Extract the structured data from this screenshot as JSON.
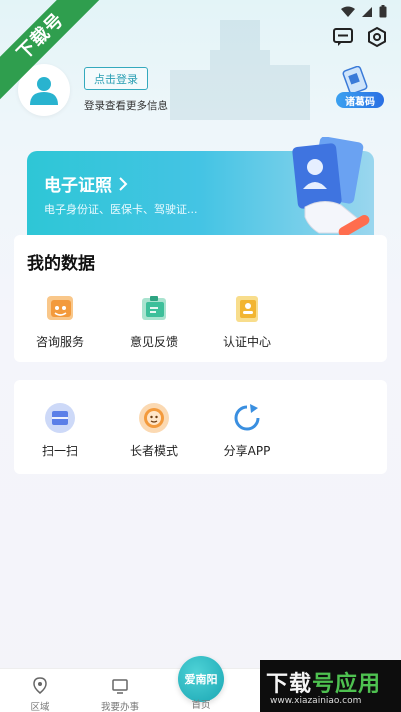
{
  "watermark": {
    "ribbon": "下载号",
    "corner_title_a": "下载",
    "corner_title_b": "号应用",
    "corner_url": "www.xiazainiao.com"
  },
  "header": {
    "login_button": "点击登录",
    "login_hint": "登录查看更多信息",
    "scan_badge": "诸葛码"
  },
  "elicense": {
    "title": "电子证照",
    "subtitle": "电子身份证、医保卡、驾驶证..."
  },
  "my_data": {
    "title": "我的数据",
    "items": [
      {
        "label": "咨询服务",
        "icon": "consult-icon",
        "color": "#f39a3c"
      },
      {
        "label": "意见反馈",
        "icon": "feedback-icon",
        "color": "#3dbf9a"
      },
      {
        "label": "认证中心",
        "icon": "certification-icon",
        "color": "#f2b531"
      }
    ]
  },
  "tools": {
    "items": [
      {
        "label": "扫一扫",
        "icon": "scan-icon",
        "color": "#5b7fe8"
      },
      {
        "label": "长者模式",
        "icon": "elder-mode-icon",
        "color": "#f39a3c"
      },
      {
        "label": "分享APP",
        "icon": "share-icon",
        "color": "#3a8fe0"
      }
    ]
  },
  "bottom_nav": {
    "items": [
      {
        "label": "区域",
        "icon": "location-icon"
      },
      {
        "label": "我要办事",
        "icon": "service-icon"
      },
      {
        "label": "首页",
        "icon": "home-icon"
      }
    ],
    "home_center_text": "爱南阳"
  },
  "colors": {
    "accent": "#2ec6d6",
    "button_border": "#34a9bd"
  }
}
